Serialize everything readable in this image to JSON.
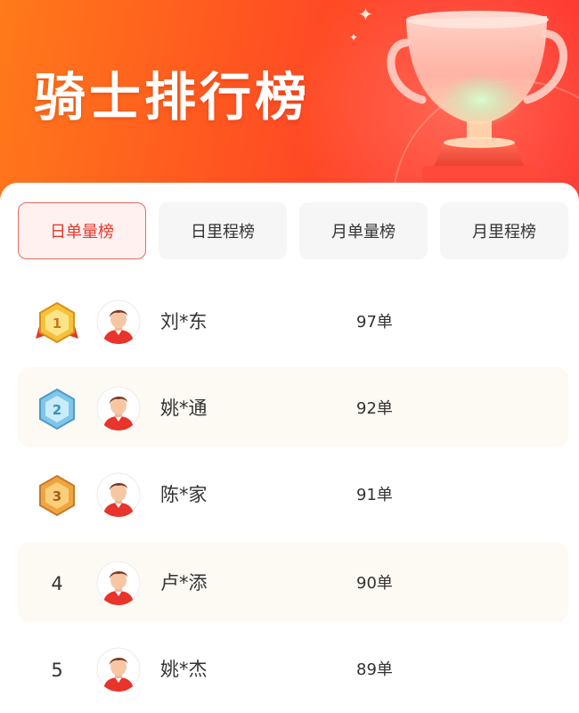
{
  "page_title": "骑士排行榜",
  "tabs": [
    {
      "label": "日单量榜",
      "active": true
    },
    {
      "label": "日里程榜",
      "active": false
    },
    {
      "label": "月单量榜",
      "active": false
    },
    {
      "label": "月里程榜",
      "active": false
    }
  ],
  "rankings": [
    {
      "rank": "1",
      "badge": "gold-medal-icon",
      "name": "刘*东",
      "count": "97单"
    },
    {
      "rank": "2",
      "badge": "silver-medal-icon",
      "name": "姚*通",
      "count": "92单"
    },
    {
      "rank": "3",
      "badge": "bronze-medal-icon",
      "name": "陈*家",
      "count": "91单"
    },
    {
      "rank": "4",
      "name": "卢*添",
      "count": "90单"
    },
    {
      "rank": "5",
      "name": "姚*杰",
      "count": "89单"
    }
  ],
  "colors": {
    "header_start": "#ff7a1a",
    "header_end": "#ff3a32",
    "active_tab_text": "#e8382c",
    "active_tab_bg": "#fff1ef",
    "alt_row_bg": "#fdf9f3",
    "gold": "#f2b632",
    "silver": "#7fc6ea",
    "bronze": "#f0a640"
  },
  "icons": {
    "trophy": "trophy-icon",
    "avatar": "rider-avatar-icon",
    "sparkle": "sparkle-icon"
  }
}
